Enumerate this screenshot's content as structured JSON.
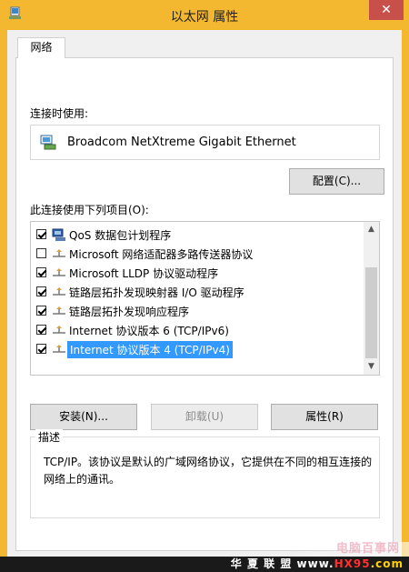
{
  "window": {
    "title": "以太网 属性",
    "close_glyph": "✕"
  },
  "tabs": [
    {
      "label": "网络"
    }
  ],
  "connect_using": {
    "label": "连接时使用:",
    "adapter_name": "Broadcom NetXtreme Gigabit Ethernet",
    "configure_button": "配置(C)..."
  },
  "items_section": {
    "label": "此连接使用下列项目(O):",
    "items": [
      {
        "checked": true,
        "icon": "qos-icon",
        "label": "QoS 数据包计划程序",
        "selected": false
      },
      {
        "checked": false,
        "icon": "protocol-icon",
        "label": "Microsoft 网络适配器多路传送器协议",
        "selected": false
      },
      {
        "checked": true,
        "icon": "protocol-icon",
        "label": "Microsoft LLDP 协议驱动程序",
        "selected": false
      },
      {
        "checked": true,
        "icon": "protocol-icon",
        "label": "链路层拓扑发现映射器 I/O 驱动程序",
        "selected": false
      },
      {
        "checked": true,
        "icon": "protocol-icon",
        "label": "链路层拓扑发现响应程序",
        "selected": false
      },
      {
        "checked": true,
        "icon": "protocol-icon",
        "label": "Internet 协议版本 6 (TCP/IPv6)",
        "selected": false
      },
      {
        "checked": true,
        "icon": "protocol-icon",
        "label": "Internet 协议版本 4 (TCP/IPv4)",
        "selected": true
      }
    ],
    "scroll_up_glyph": "▲",
    "scroll_down_glyph": "▼"
  },
  "actions": {
    "install": "安装(N)...",
    "uninstall": "卸载(U)",
    "properties": "属性(R)"
  },
  "description": {
    "legend": "描述",
    "text": "TCP/IP。该协议是默认的广域网络协议，它提供在不同的相互连接的网络上的通讯。"
  },
  "watermark": {
    "faded": "电脑百事网",
    "prefix": "华 夏 联 盟  ",
    "www": "www.",
    "domain": "HX95",
    "tld": ".com"
  },
  "colors": {
    "titlebar": "#f3b830",
    "close": "#c7504a",
    "selection": "#3399ff"
  }
}
